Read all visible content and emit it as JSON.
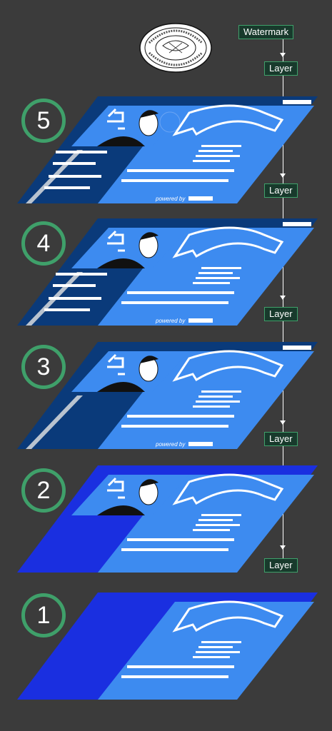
{
  "labels": {
    "watermark": "Watermark",
    "layer": "Layer"
  },
  "seal_text": "ACADEMY STUDENT",
  "layers": [
    {
      "number": "5",
      "powered_by": "powered by"
    },
    {
      "number": "4",
      "powered_by": "powered by"
    },
    {
      "number": "3",
      "powered_by": "powered by"
    },
    {
      "number": "2"
    },
    {
      "number": "1"
    }
  ],
  "colors": {
    "background": "#3b3b3b",
    "dark_blue": "#0a3a7a",
    "light_blue": "#3d8bf0",
    "royal_blue": "#1a2fe0",
    "badge_green": "#3fa06a"
  }
}
